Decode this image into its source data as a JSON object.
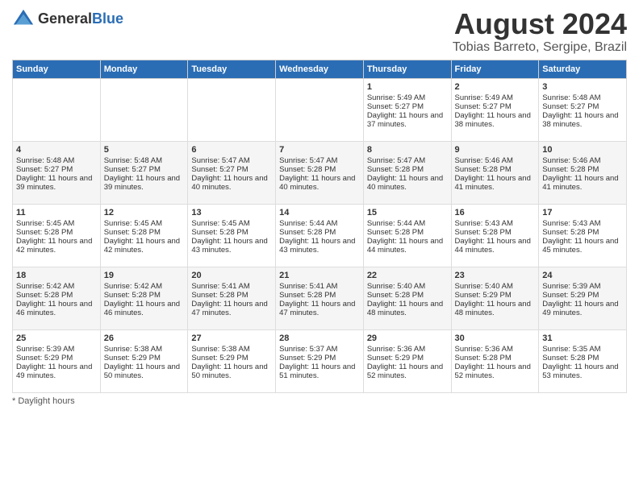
{
  "header": {
    "logo_general": "General",
    "logo_blue": "Blue",
    "title": "August 2024",
    "subtitle": "Tobias Barreto, Sergipe, Brazil"
  },
  "days_of_week": [
    "Sunday",
    "Monday",
    "Tuesday",
    "Wednesday",
    "Thursday",
    "Friday",
    "Saturday"
  ],
  "footer": {
    "note": "Daylight hours"
  },
  "weeks": [
    [
      {
        "day": "",
        "sunrise": "",
        "sunset": "",
        "daylight": ""
      },
      {
        "day": "",
        "sunrise": "",
        "sunset": "",
        "daylight": ""
      },
      {
        "day": "",
        "sunrise": "",
        "sunset": "",
        "daylight": ""
      },
      {
        "day": "",
        "sunrise": "",
        "sunset": "",
        "daylight": ""
      },
      {
        "day": "1",
        "sunrise": "Sunrise: 5:49 AM",
        "sunset": "Sunset: 5:27 PM",
        "daylight": "Daylight: 11 hours and 37 minutes."
      },
      {
        "day": "2",
        "sunrise": "Sunrise: 5:49 AM",
        "sunset": "Sunset: 5:27 PM",
        "daylight": "Daylight: 11 hours and 38 minutes."
      },
      {
        "day": "3",
        "sunrise": "Sunrise: 5:48 AM",
        "sunset": "Sunset: 5:27 PM",
        "daylight": "Daylight: 11 hours and 38 minutes."
      }
    ],
    [
      {
        "day": "4",
        "sunrise": "Sunrise: 5:48 AM",
        "sunset": "Sunset: 5:27 PM",
        "daylight": "Daylight: 11 hours and 39 minutes."
      },
      {
        "day": "5",
        "sunrise": "Sunrise: 5:48 AM",
        "sunset": "Sunset: 5:27 PM",
        "daylight": "Daylight: 11 hours and 39 minutes."
      },
      {
        "day": "6",
        "sunrise": "Sunrise: 5:47 AM",
        "sunset": "Sunset: 5:27 PM",
        "daylight": "Daylight: 11 hours and 40 minutes."
      },
      {
        "day": "7",
        "sunrise": "Sunrise: 5:47 AM",
        "sunset": "Sunset: 5:28 PM",
        "daylight": "Daylight: 11 hours and 40 minutes."
      },
      {
        "day": "8",
        "sunrise": "Sunrise: 5:47 AM",
        "sunset": "Sunset: 5:28 PM",
        "daylight": "Daylight: 11 hours and 40 minutes."
      },
      {
        "day": "9",
        "sunrise": "Sunrise: 5:46 AM",
        "sunset": "Sunset: 5:28 PM",
        "daylight": "Daylight: 11 hours and 41 minutes."
      },
      {
        "day": "10",
        "sunrise": "Sunrise: 5:46 AM",
        "sunset": "Sunset: 5:28 PM",
        "daylight": "Daylight: 11 hours and 41 minutes."
      }
    ],
    [
      {
        "day": "11",
        "sunrise": "Sunrise: 5:45 AM",
        "sunset": "Sunset: 5:28 PM",
        "daylight": "Daylight: 11 hours and 42 minutes."
      },
      {
        "day": "12",
        "sunrise": "Sunrise: 5:45 AM",
        "sunset": "Sunset: 5:28 PM",
        "daylight": "Daylight: 11 hours and 42 minutes."
      },
      {
        "day": "13",
        "sunrise": "Sunrise: 5:45 AM",
        "sunset": "Sunset: 5:28 PM",
        "daylight": "Daylight: 11 hours and 43 minutes."
      },
      {
        "day": "14",
        "sunrise": "Sunrise: 5:44 AM",
        "sunset": "Sunset: 5:28 PM",
        "daylight": "Daylight: 11 hours and 43 minutes."
      },
      {
        "day": "15",
        "sunrise": "Sunrise: 5:44 AM",
        "sunset": "Sunset: 5:28 PM",
        "daylight": "Daylight: 11 hours and 44 minutes."
      },
      {
        "day": "16",
        "sunrise": "Sunrise: 5:43 AM",
        "sunset": "Sunset: 5:28 PM",
        "daylight": "Daylight: 11 hours and 44 minutes."
      },
      {
        "day": "17",
        "sunrise": "Sunrise: 5:43 AM",
        "sunset": "Sunset: 5:28 PM",
        "daylight": "Daylight: 11 hours and 45 minutes."
      }
    ],
    [
      {
        "day": "18",
        "sunrise": "Sunrise: 5:42 AM",
        "sunset": "Sunset: 5:28 PM",
        "daylight": "Daylight: 11 hours and 46 minutes."
      },
      {
        "day": "19",
        "sunrise": "Sunrise: 5:42 AM",
        "sunset": "Sunset: 5:28 PM",
        "daylight": "Daylight: 11 hours and 46 minutes."
      },
      {
        "day": "20",
        "sunrise": "Sunrise: 5:41 AM",
        "sunset": "Sunset: 5:28 PM",
        "daylight": "Daylight: 11 hours and 47 minutes."
      },
      {
        "day": "21",
        "sunrise": "Sunrise: 5:41 AM",
        "sunset": "Sunset: 5:28 PM",
        "daylight": "Daylight: 11 hours and 47 minutes."
      },
      {
        "day": "22",
        "sunrise": "Sunrise: 5:40 AM",
        "sunset": "Sunset: 5:28 PM",
        "daylight": "Daylight: 11 hours and 48 minutes."
      },
      {
        "day": "23",
        "sunrise": "Sunrise: 5:40 AM",
        "sunset": "Sunset: 5:29 PM",
        "daylight": "Daylight: 11 hours and 48 minutes."
      },
      {
        "day": "24",
        "sunrise": "Sunrise: 5:39 AM",
        "sunset": "Sunset: 5:29 PM",
        "daylight": "Daylight: 11 hours and 49 minutes."
      }
    ],
    [
      {
        "day": "25",
        "sunrise": "Sunrise: 5:39 AM",
        "sunset": "Sunset: 5:29 PM",
        "daylight": "Daylight: 11 hours and 49 minutes."
      },
      {
        "day": "26",
        "sunrise": "Sunrise: 5:38 AM",
        "sunset": "Sunset: 5:29 PM",
        "daylight": "Daylight: 11 hours and 50 minutes."
      },
      {
        "day": "27",
        "sunrise": "Sunrise: 5:38 AM",
        "sunset": "Sunset: 5:29 PM",
        "daylight": "Daylight: 11 hours and 50 minutes."
      },
      {
        "day": "28",
        "sunrise": "Sunrise: 5:37 AM",
        "sunset": "Sunset: 5:29 PM",
        "daylight": "Daylight: 11 hours and 51 minutes."
      },
      {
        "day": "29",
        "sunrise": "Sunrise: 5:36 AM",
        "sunset": "Sunset: 5:29 PM",
        "daylight": "Daylight: 11 hours and 52 minutes."
      },
      {
        "day": "30",
        "sunrise": "Sunrise: 5:36 AM",
        "sunset": "Sunset: 5:28 PM",
        "daylight": "Daylight: 11 hours and 52 minutes."
      },
      {
        "day": "31",
        "sunrise": "Sunrise: 5:35 AM",
        "sunset": "Sunset: 5:28 PM",
        "daylight": "Daylight: 11 hours and 53 minutes."
      }
    ]
  ]
}
